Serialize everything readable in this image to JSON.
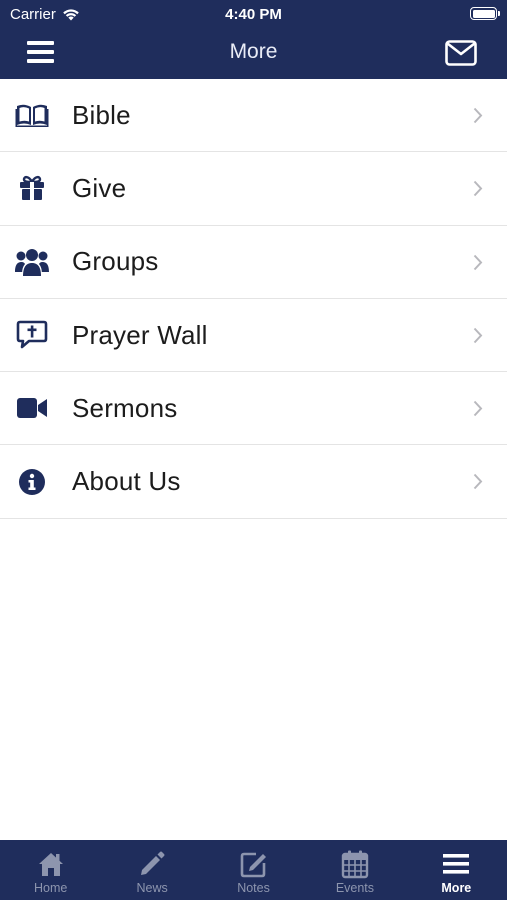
{
  "status_bar": {
    "carrier": "Carrier",
    "time": "4:40 PM"
  },
  "header": {
    "title": "More",
    "menu_icon": "hamburger-icon",
    "mail_icon": "envelope-icon"
  },
  "colors": {
    "brand": "#1f2d5c",
    "icon": "#1f2d5c",
    "tab_inactive": "#8d95ae",
    "tab_active": "#ffffff"
  },
  "menu": {
    "items": [
      {
        "label": "Bible",
        "icon": "book-icon"
      },
      {
        "label": "Give",
        "icon": "gift-icon"
      },
      {
        "label": "Groups",
        "icon": "group-icon"
      },
      {
        "label": "Prayer Wall",
        "icon": "prayer-bubble-icon"
      },
      {
        "label": "Sermons",
        "icon": "video-camera-icon"
      },
      {
        "label": "About Us",
        "icon": "info-icon"
      }
    ]
  },
  "tabbar": {
    "tabs": [
      {
        "label": "Home",
        "icon": "home-icon"
      },
      {
        "label": "News",
        "icon": "pencil-icon"
      },
      {
        "label": "Notes",
        "icon": "note-edit-icon"
      },
      {
        "label": "Events",
        "icon": "calendar-icon"
      },
      {
        "label": "More",
        "icon": "hamburger-icon",
        "active": true
      }
    ]
  }
}
